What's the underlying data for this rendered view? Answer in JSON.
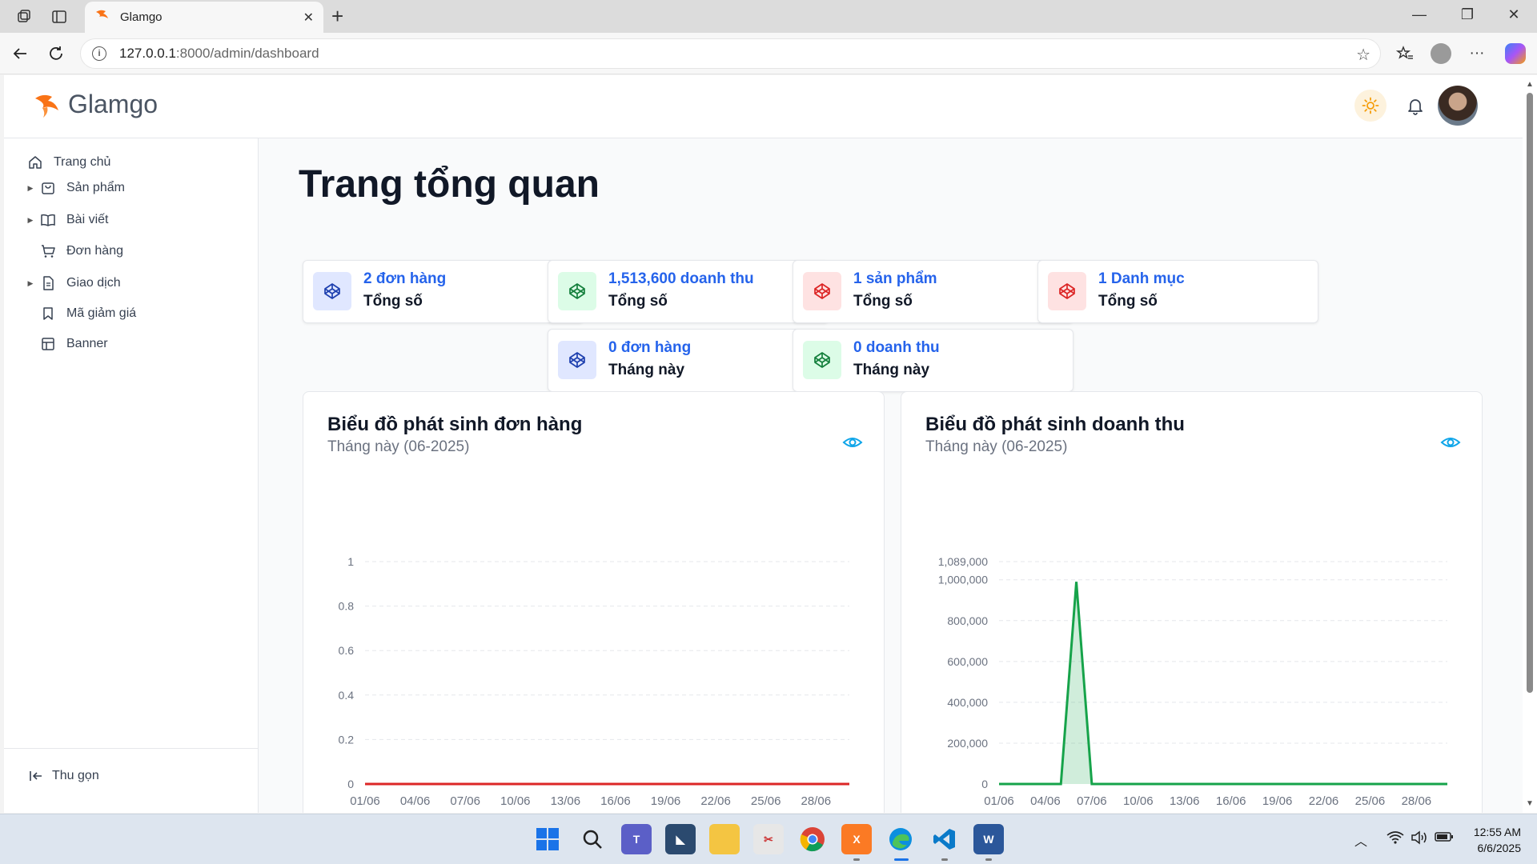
{
  "browser": {
    "tab_title": "Glamgo",
    "url_host": "127.0.0.1",
    "url_rest": ":8000/admin/dashboard"
  },
  "app": {
    "brand": "Glamgo",
    "accent": "#2563eb",
    "logo_color": "#f97316"
  },
  "sidebar": {
    "items": [
      {
        "label": "Trang chủ",
        "icon": "home-icon"
      },
      {
        "label": "Sản phẩm",
        "icon": "shopping-bag-icon"
      },
      {
        "label": "Bài viết",
        "icon": "book-icon"
      },
      {
        "label": "Đơn hàng",
        "icon": "cart-icon"
      },
      {
        "label": "Giao dịch",
        "icon": "document-icon"
      },
      {
        "label": "Mã giảm giá",
        "icon": "bookmark-icon"
      },
      {
        "label": "Banner",
        "icon": "layout-icon"
      }
    ],
    "collapse_label": "Thu gọn"
  },
  "main": {
    "title": "Trang tổng quan",
    "stats": [
      {
        "value": "2 đơn hàng",
        "label": "Tổng số",
        "color": "blue"
      },
      {
        "value": "1,513,600 doanh thu",
        "label": "Tổng số",
        "color": "green"
      },
      {
        "value": "1 sản phẩm",
        "label": "Tổng số",
        "color": "red"
      },
      {
        "value": "1 Danh mục",
        "label": "Tổng số",
        "color": "red"
      },
      {
        "value": "0 đơn hàng",
        "label": "Tháng này",
        "color": "blue"
      },
      {
        "value": "0 doanh thu",
        "label": "Tháng này",
        "color": "green"
      }
    ]
  },
  "chart_data": [
    {
      "type": "line",
      "title": "Biểu đồ phát sinh đơn hàng",
      "subtitle": "Tháng này (06-2025)",
      "x_tick_labels": [
        "01/06",
        "04/06",
        "07/06",
        "10/06",
        "13/06",
        "16/06",
        "19/06",
        "22/06",
        "25/06",
        "28/06"
      ],
      "y_tick_labels": [
        "0",
        "0.2",
        "0.4",
        "0.6",
        "0.8",
        "1"
      ],
      "ylim": [
        0,
        1
      ],
      "x_days": [
        1,
        30
      ],
      "series": [
        {
          "x": [
            1,
            30
          ],
          "values": [
            0,
            0
          ],
          "color": "#dc2626"
        }
      ],
      "grid": true
    },
    {
      "type": "area",
      "title": "Biểu đồ phát sinh doanh thu",
      "subtitle": "Tháng này (06-2025)",
      "x_tick_labels": [
        "01/06",
        "04/06",
        "07/06",
        "10/06",
        "13/06",
        "16/06",
        "19/06",
        "22/06",
        "25/06",
        "28/06"
      ],
      "y_tick_labels": [
        "0",
        "200,000",
        "400,000",
        "600,000",
        "800,000",
        "1,000,000",
        "1,089,000"
      ],
      "ylim": [
        0,
        1089000
      ],
      "x_days": [
        1,
        30
      ],
      "series": [
        {
          "x": [
            1,
            2,
            3,
            4,
            5,
            6,
            7,
            30
          ],
          "values": [
            0,
            0,
            0,
            0,
            0,
            990000,
            0,
            0
          ],
          "color": "#16a34a"
        }
      ],
      "grid": true
    }
  ],
  "taskbar": {
    "time": "12:55 AM",
    "date": "6/6/2025"
  }
}
